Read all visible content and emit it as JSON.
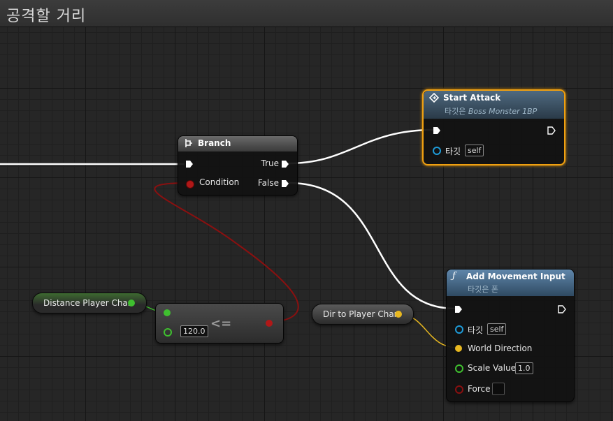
{
  "graph": {
    "title": "공격할 거리"
  },
  "colors": {
    "exec_wire": "#ffffff",
    "bool_wire": "#8a1010",
    "float_wire": "#3fbf2f",
    "vector_wire": "#e8b820",
    "object_pin": "#1e9bd8",
    "selected_outline": "#f0a010",
    "function_header": "#5a7a99"
  },
  "branch_node": {
    "icon": "branch-icon",
    "title": "Branch",
    "true_label": "True",
    "false_label": "False",
    "condition_label": "Condition"
  },
  "start_attack_node": {
    "icon": "event-diamond-icon",
    "title": "Start Attack",
    "subtitle_prefix": "타깃은",
    "subtitle_target": "Boss Monster 1BP",
    "target_label": "타깃",
    "target_value": "self"
  },
  "add_movement_node": {
    "icon": "function-icon",
    "title": "Add Movement Input",
    "subtitle": "타깃은 폰",
    "target_label": "타깃",
    "target_value": "self",
    "world_direction_label": "World Direction",
    "scale_value_label": "Scale Value",
    "scale_value": "1.0",
    "force_label": "Force"
  },
  "distance_node": {
    "label": "Distance Player Char"
  },
  "compare_node": {
    "operator": "<=",
    "value": "120.0"
  },
  "dir_node": {
    "label": "Dir to Player Char"
  }
}
